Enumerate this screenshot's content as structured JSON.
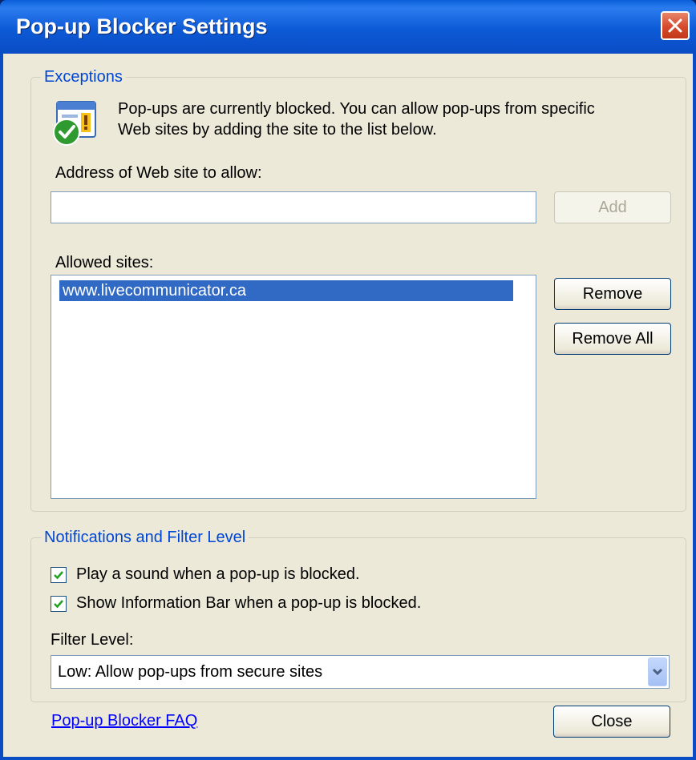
{
  "window": {
    "title": "Pop-up Blocker Settings"
  },
  "exceptions": {
    "legend": "Exceptions",
    "description_line1": "Pop-ups are currently blocked.  You can allow pop-ups from specific",
    "description_line2": "Web sites by adding the site to the list below.",
    "address_label": "Address of Web site to allow:",
    "address_value": "",
    "add_label": "Add",
    "allowed_label": "Allowed sites:",
    "allowed_sites": [
      "www.livecommunicator.ca"
    ],
    "remove_label": "Remove",
    "remove_all_label": "Remove All"
  },
  "notifications": {
    "legend": "Notifications and Filter Level",
    "play_sound_label": "Play a sound when a pop-up is blocked.",
    "play_sound_checked": true,
    "info_bar_label": "Show Information Bar when a pop-up is blocked.",
    "info_bar_checked": true,
    "filter_level_label": "Filter Level:",
    "filter_level_value": "Low: Allow pop-ups from secure sites"
  },
  "footer": {
    "faq_link": "Pop-up Blocker FAQ",
    "close_label": "Close"
  },
  "colors": {
    "titlebar": "#0a5fd8",
    "dialog_bg": "#ece9d8",
    "group_legend": "#0046d5",
    "selection": "#316ac5"
  }
}
